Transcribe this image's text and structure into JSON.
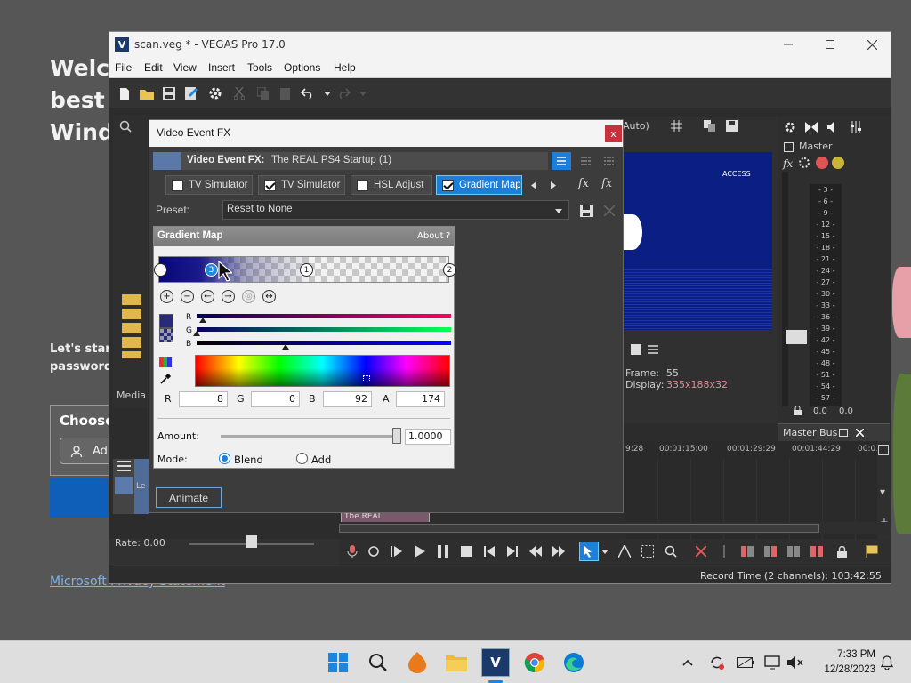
{
  "background": {
    "welcome_lines": [
      "Welco",
      "best p",
      "Windo"
    ],
    "lets_start": "Let's start",
    "passwords": "passwords",
    "choose": "Choose",
    "add": "Ad",
    "privacy_link": "Microsoft Privacy Statement"
  },
  "window": {
    "title": "scan.veg * - VEGAS Pro 17.0",
    "app_icon_letter": "V"
  },
  "menu": [
    "File",
    "Edit",
    "View",
    "Insert",
    "Tools",
    "Options",
    "Help"
  ],
  "preview": {
    "quality_label": "Auto)",
    "frame_label": "Frame:",
    "frame_value": "55",
    "display_label": "Display:",
    "display_value": "335x188x32",
    "video_text": "ACCESS"
  },
  "master": {
    "label": "Master",
    "meter_ticks": [
      "3",
      "6",
      "9",
      "12",
      "15",
      "18",
      "21",
      "24",
      "27",
      "30",
      "33",
      "36",
      "39",
      "42",
      "45",
      "48",
      "51",
      "54",
      "57"
    ],
    "left_value": "0.0",
    "right_value": "0.0",
    "bus_label": "Master Bus"
  },
  "timeline": {
    "times": [
      "9:28",
      "00:01:15:00",
      "00:01:29:29",
      "00:01:44:29",
      "00:01:5"
    ],
    "clip_label": "The REAL"
  },
  "transport": {
    "rate_label": "Rate: 0.00"
  },
  "status": {
    "record_time": "Record Time (2 channels): 103:42:55"
  },
  "dialog": {
    "title": "Video Event FX",
    "close": "x",
    "chain_label": "Video Event FX:",
    "chain_name": "The REAL PS4 Startup (1)",
    "plugins": [
      {
        "name": "TV Simulator",
        "checked": false
      },
      {
        "name": "TV Simulator",
        "checked": true
      },
      {
        "name": "HSL Adjust",
        "checked": false
      },
      {
        "name": "Gradient Map",
        "checked": true,
        "selected": true
      }
    ],
    "preset_label": "Preset:",
    "preset_value": "Reset to None",
    "gradient_map": {
      "title": "Gradient Map",
      "about": "About",
      "help": "?",
      "stops": [
        "3",
        "1",
        "2"
      ],
      "channel_labels": [
        "R",
        "G",
        "B"
      ],
      "r_label": "R",
      "r_value": "8",
      "g_label": "G",
      "g_value": "0",
      "b_label": "B",
      "b_value": "92",
      "a_label": "A",
      "a_value": "174",
      "amount_label": "Amount:",
      "amount_value": "1.0000",
      "amount_fraction": 1.0,
      "mode_label": "Mode:",
      "mode_blend": "Blend",
      "mode_add": "Add",
      "mode_selected": "Blend"
    },
    "animate": "Animate"
  },
  "left_panel": {
    "media_tab": "Media",
    "track_label": "Le"
  },
  "taskbar": {
    "time": "7:33 PM",
    "date": "12/28/2023"
  },
  "colors": {
    "accent": "#1e88e5",
    "selected_plugin": "#1e7fd8",
    "gradient_start": "#07077a",
    "taskbar": "#dedede"
  }
}
